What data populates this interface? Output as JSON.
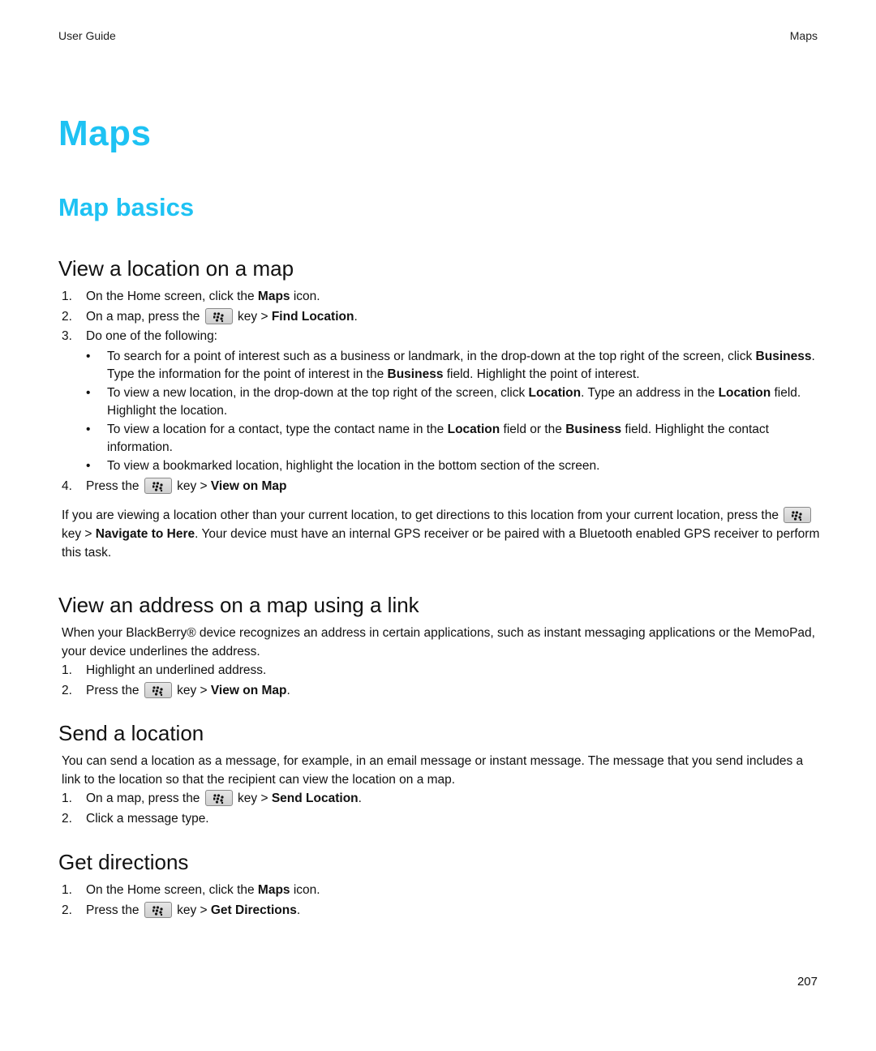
{
  "header": {
    "left": "User Guide",
    "right": "Maps"
  },
  "title": "Maps",
  "subtitle": "Map basics",
  "key_icon": "blackberry-menu-key-icon",
  "colors": {
    "heading_accent": "#1ec2f3"
  },
  "sections": {
    "view_location": {
      "heading": "View a location on a map",
      "steps": [
        {
          "num": "1.",
          "pre": "On the Home screen, click the ",
          "bold": "Maps",
          "post": " icon."
        },
        {
          "num": "2.",
          "pre": "On a map, press the ",
          "key_suffix": " key > ",
          "bold": "Find Location",
          "post": "."
        },
        {
          "num": "3.",
          "text": "Do one of the following:"
        },
        {
          "num": "4.",
          "pre": "Press the ",
          "key_suffix": " key > ",
          "bold": "View on Map",
          "post": ""
        }
      ],
      "bullets": [
        {
          "t1": "To search for a point of interest such as a business or landmark, in the drop-down at the top right of the screen, click ",
          "b1": "Business",
          "t2": ". Type the information for the point of interest in the ",
          "b2": "Business",
          "t3": " field. Highlight the point of interest."
        },
        {
          "t1": "To view a new location, in the drop-down at the top right of the screen, click ",
          "b1": "Location",
          "t2": ". Type an address in the ",
          "b2": "Location",
          "t3": " field. Highlight the location."
        },
        {
          "t1": "To view a location for a contact, type the contact name in the ",
          "b1": "Location",
          "t2": " field or the ",
          "b2": "Business",
          "t3": " field. Highlight the contact information."
        },
        {
          "t1": "To view a bookmarked location, highlight the location in the bottom section of the screen."
        }
      ],
      "note": {
        "pre": "If you are viewing a location other than your current location, to get directions to this location from your current location, press the ",
        "key_suffix": " key > ",
        "bold": "Navigate to Here",
        "post": ". Your device must have an internal GPS receiver or be paired with a Bluetooth enabled GPS receiver to perform this task."
      }
    },
    "address_link": {
      "heading": "View an address on a map using a link",
      "intro": "When your BlackBerry® device recognizes an address in certain applications, such as instant messaging applications or the MemoPad, your device underlines the address.",
      "steps": [
        {
          "num": "1.",
          "text": "Highlight an underlined address."
        },
        {
          "num": "2.",
          "pre": "Press the ",
          "key_suffix": " key > ",
          "bold": "View on Map",
          "post": "."
        }
      ]
    },
    "send_location": {
      "heading": "Send a location",
      "intro": "You can send a location as a message, for example, in an email message or instant message. The message that you send includes a link to the location so that the recipient can view the location on a map.",
      "steps": [
        {
          "num": "1.",
          "pre": "On a map, press the ",
          "key_suffix": " key > ",
          "bold": "Send Location",
          "post": "."
        },
        {
          "num": "2.",
          "text": "Click a message type."
        }
      ]
    },
    "directions": {
      "heading": "Get directions",
      "steps": [
        {
          "num": "1.",
          "pre": "On the Home screen, click the ",
          "bold": "Maps",
          "post": " icon."
        },
        {
          "num": "2.",
          "pre": "Press the ",
          "key_suffix": " key > ",
          "bold": "Get Directions",
          "post": "."
        }
      ]
    }
  },
  "bullet_char": "•",
  "page_number": "207"
}
